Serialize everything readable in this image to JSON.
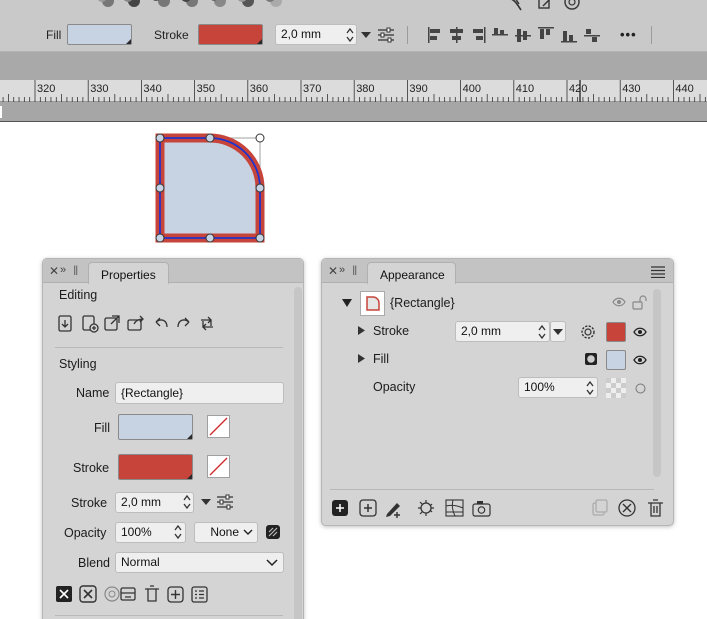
{
  "toolbar": {
    "fill_label": "Fill",
    "stroke_label": "Stroke",
    "stroke_width": "2,0 mm",
    "fill_color": "#c7d3e2",
    "stroke_color": "#c6443a",
    "more_label": "•••"
  },
  "ruler": {
    "labels": [
      "320",
      "330",
      "340",
      "350",
      "360",
      "370",
      "380",
      "390",
      "400",
      "410",
      "420",
      "430",
      "440"
    ]
  },
  "canvas": {
    "shape_fill": "#c7d3e2",
    "shape_stroke": "#c6443a",
    "path_color": "#2233cc"
  },
  "properties": {
    "tab": "Properties",
    "editing": "Editing",
    "styling": "Styling",
    "name_label": "Name",
    "name_value": "{Rectangle}",
    "fill_label": "Fill",
    "stroke_label": "Stroke",
    "stroke_width_label": "Stroke",
    "stroke_width": "2,0 mm",
    "opacity_label": "Opacity",
    "opacity_value": "100%",
    "opacity_mode": "None",
    "blend_label": "Blend",
    "blend_value": "Normal"
  },
  "appearance": {
    "tab": "Appearance",
    "object_name": "{Rectangle}",
    "stroke_label": "Stroke",
    "stroke_width": "2,0 mm",
    "fill_label": "Fill",
    "opacity_label": "Opacity",
    "opacity_value": "100%"
  }
}
